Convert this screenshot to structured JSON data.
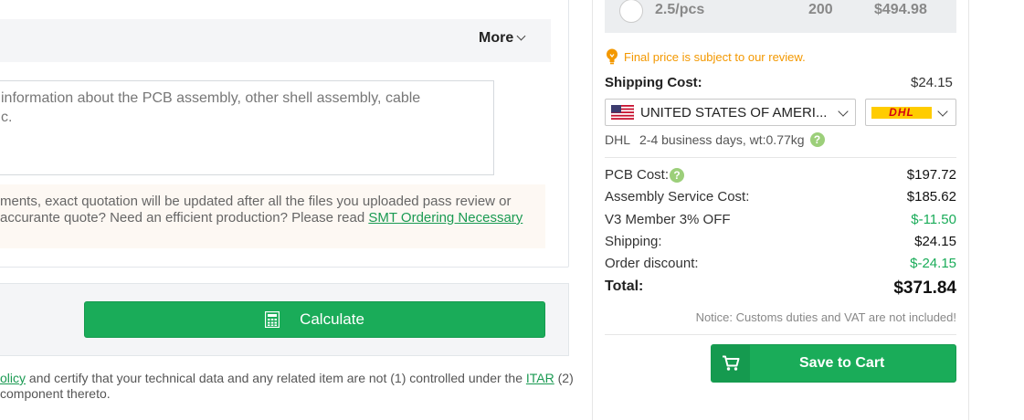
{
  "left": {
    "more_label": "More",
    "note_text": "information about the PCB assembly, other shell assembly, cable\nc.",
    "notice_line1": "ments, exact quotation will be updated after all the files you uploaded pass review or",
    "notice_line2": "accurante quote? Need an efficient production? Please read ",
    "notice_link": "SMT Ordering Necessary",
    "calculate_label": "Calculate",
    "terms_prefix": "olicy",
    "terms_middle": " and certify that your technical data and any related item are not (1) controlled under the ",
    "terms_itar": "ITAR",
    "terms_suffix": " (2)",
    "terms_line2": "component thereto."
  },
  "price_row": {
    "unit_price": "2.5/pcs",
    "quantity": "200",
    "total": "$494.98"
  },
  "final_note": "Final price is subject to our review.",
  "shipping": {
    "label": "Shipping Cost:",
    "value": "$24.15",
    "country": "UNITED STATES OF AMERI...",
    "carrier_logo_text": "DHL",
    "carrier": "DHL",
    "detail": "2-4 business days, wt:0.77kg"
  },
  "costs": [
    {
      "label": "PCB Cost:",
      "value": "$197.72"
    },
    {
      "label": "Assembly Service Cost:",
      "value": "$185.62"
    },
    {
      "label": "V3 Member 3% OFF",
      "value": "$-11.50"
    },
    {
      "label": "Shipping:",
      "value": "$24.15"
    },
    {
      "label": "Order discount:",
      "value": "$-24.15"
    }
  ],
  "total": {
    "label": "Total:",
    "value": "$371.84"
  },
  "customs_notice": "Notice: Customs duties and VAT are not included!",
  "save_label": "Save to Cart",
  "colors": {
    "accent_green": "#1aac59",
    "warning_orange": "#f39800",
    "discount_green": "#1aac59"
  }
}
